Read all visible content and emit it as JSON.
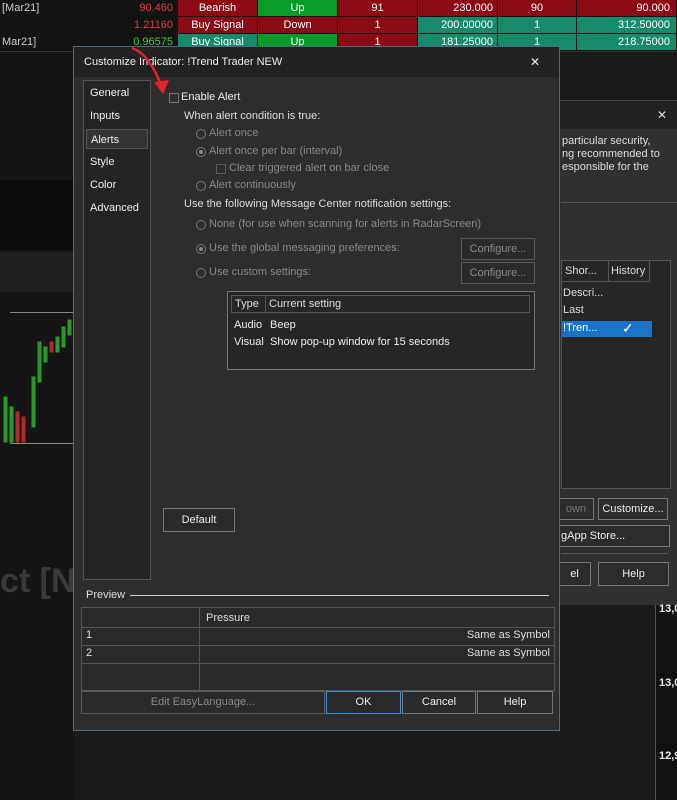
{
  "quotes": [
    {
      "symbol": "[Mar21]",
      "value": "90.460",
      "value_color": "#e83a3a",
      "signal": "Bearish",
      "signal_bg": "red",
      "direction": "Up",
      "direction_bg": "grn",
      "n1": "91",
      "price": "230.000",
      "mid": "90",
      "last": "90.000"
    },
    {
      "symbol": "",
      "value": "1.21160",
      "value_color": "#e83a3a",
      "signal": "Buy Signal",
      "signal_bg": "red",
      "direction": "Down",
      "direction_bg": "red",
      "n1": "1",
      "price": "200.00000",
      "mid": "1",
      "last": "312.50000"
    },
    {
      "symbol": "Mar21]",
      "value": "0.96575",
      "value_color": "#35d335",
      "signal": "Buy Signal",
      "signal_bg": "teal",
      "direction": "Up",
      "direction_bg": "grn",
      "n1": "1",
      "price": "181.25000",
      "mid": "1",
      "last": "218.75000"
    }
  ],
  "background": {
    "partial_text": [
      "particular security,",
      "ng recommended to",
      "esponsible for the"
    ],
    "col_headers": [
      "Shor...",
      "History"
    ],
    "list_items": [
      "Descri...",
      "Last",
      "!Tren..."
    ],
    "checkmark": "✓",
    "own_label": "own",
    "customize_label": "Customize...",
    "store_label": "gApp Store...",
    "el_label": "el",
    "help_label": "Help",
    "close_glyph": "✕",
    "watermark": "ct [N",
    "prices": [
      "13,0",
      "13,0",
      "12,9"
    ]
  },
  "dialog": {
    "title": "Customize Indicator: !Trend Trader NEW",
    "close_glyph": "✕",
    "nav": [
      "General",
      "Inputs",
      "Alerts",
      "Style",
      "Color",
      "Advanced"
    ],
    "active_nav": "Alerts",
    "enable_alert": "Enable Alert",
    "when_label": "When alert condition is true:",
    "alert_once": "Alert once",
    "alert_once_per_bar": "Alert once per bar (interval)",
    "clear_triggered": "Clear triggered alert on bar close",
    "alert_continuously": "Alert continuously",
    "mc_label": "Use the following Message Center notification settings:",
    "none_option": "None (for use when scanning for alerts in RadarScreen)",
    "global_option": "Use the global messaging preferences:",
    "custom_option": "Use custom settings:",
    "configure_label": "Configure...",
    "table_headers": [
      "Type",
      "Current setting"
    ],
    "table_rows": [
      [
        "Audio",
        "Beep"
      ],
      [
        "Visual",
        "Show pop-up window for 15 seconds"
      ]
    ],
    "default_label": "Default",
    "preview_label": "Preview",
    "preview_header": "Pressure",
    "preview_rows": [
      [
        "1",
        "Same as Symbol"
      ],
      [
        "2",
        "Same as Symbol"
      ]
    ],
    "edit_label": "Edit EasyLanguage...",
    "ok_label": "OK",
    "cancel_label": "Cancel",
    "help_label": "Help"
  },
  "annotation": {
    "arrow_color": "#e8222a"
  }
}
